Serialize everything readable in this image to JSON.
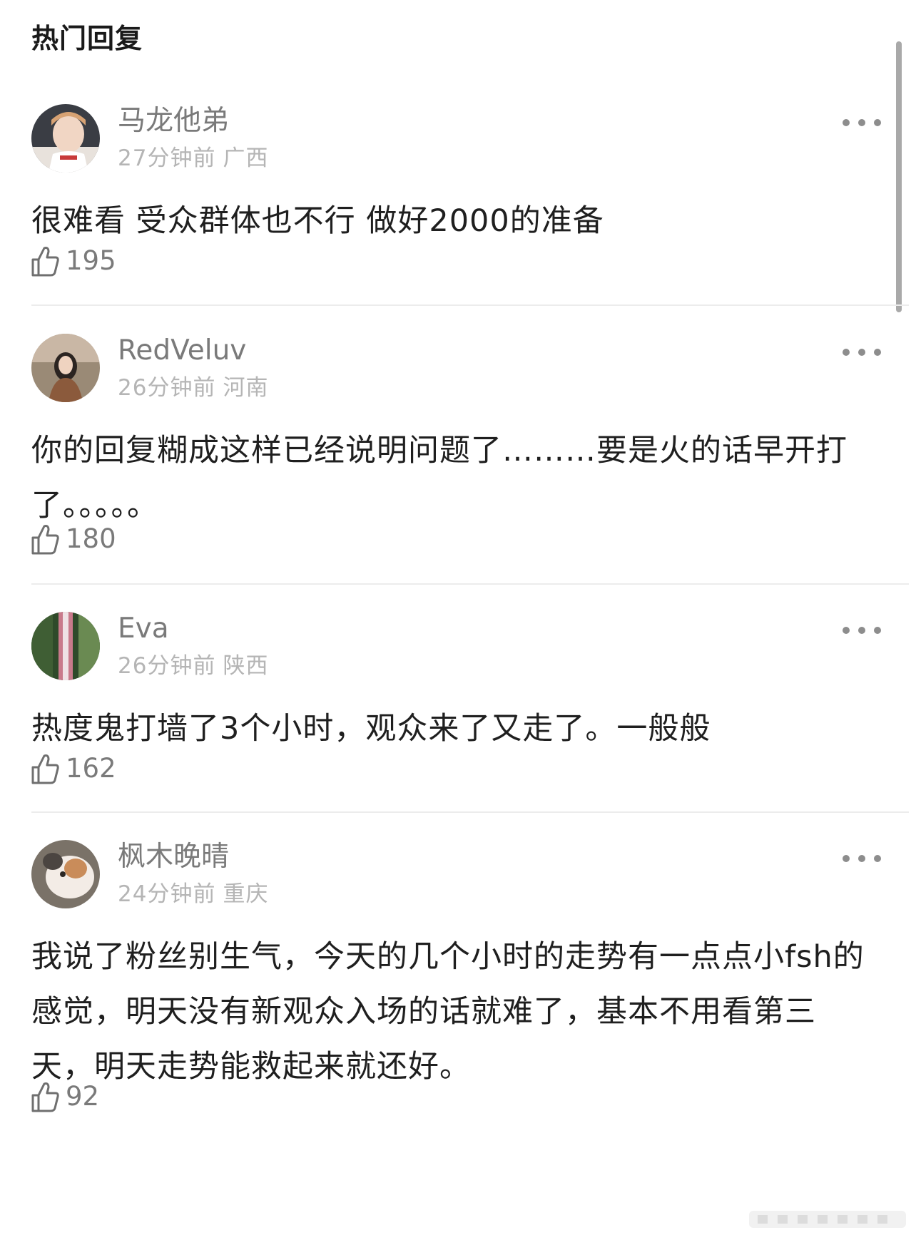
{
  "header": {
    "title": "热门回复"
  },
  "comments": [
    {
      "username": "马龙他弟",
      "time": "27分钟前",
      "location": "广西",
      "text": "很难看 受众群体也不行 做好2000的准备",
      "likes": "195",
      "avatar_colors": [
        "#3a3d44",
        "#f1d6c4",
        "#e8e2dc"
      ]
    },
    {
      "username": "RedVeluv",
      "time": "26分钟前",
      "location": "河南",
      "text": "你的回复糊成这样已经说明问题了………要是火的话早开打了。。。。。",
      "likes": "180",
      "avatar_colors": [
        "#9a8a76",
        "#2b2421",
        "#c9b7a5"
      ]
    },
    {
      "username": "Eva",
      "time": "26分钟前",
      "location": "陕西",
      "text": "热度鬼打墙了3个小时，观众来了又走了。一般般",
      "likes": "162",
      "avatar_colors": [
        "#2f4a2a",
        "#c97a8b",
        "#6a8a52"
      ]
    },
    {
      "username": "枫木晚晴",
      "time": "24分钟前",
      "location": "重庆",
      "text": "我说了粉丝别生气，今天的几个小时的走势有一点点小fsh的感觉，明天没有新观众入场的话就难了，基本不用看第三天，明天走势能救起来就还好。",
      "likes": "92",
      "avatar_colors": [
        "#7a7268",
        "#f3ece6",
        "#c98c5a"
      ]
    }
  ],
  "icons": {
    "like": "thumbs-up-icon",
    "more": "more-options-icon"
  },
  "colors": {
    "username": "#7a7a7a",
    "meta": "#b5b5b5",
    "body": "#1f1f1f",
    "divider": "#ececec"
  }
}
